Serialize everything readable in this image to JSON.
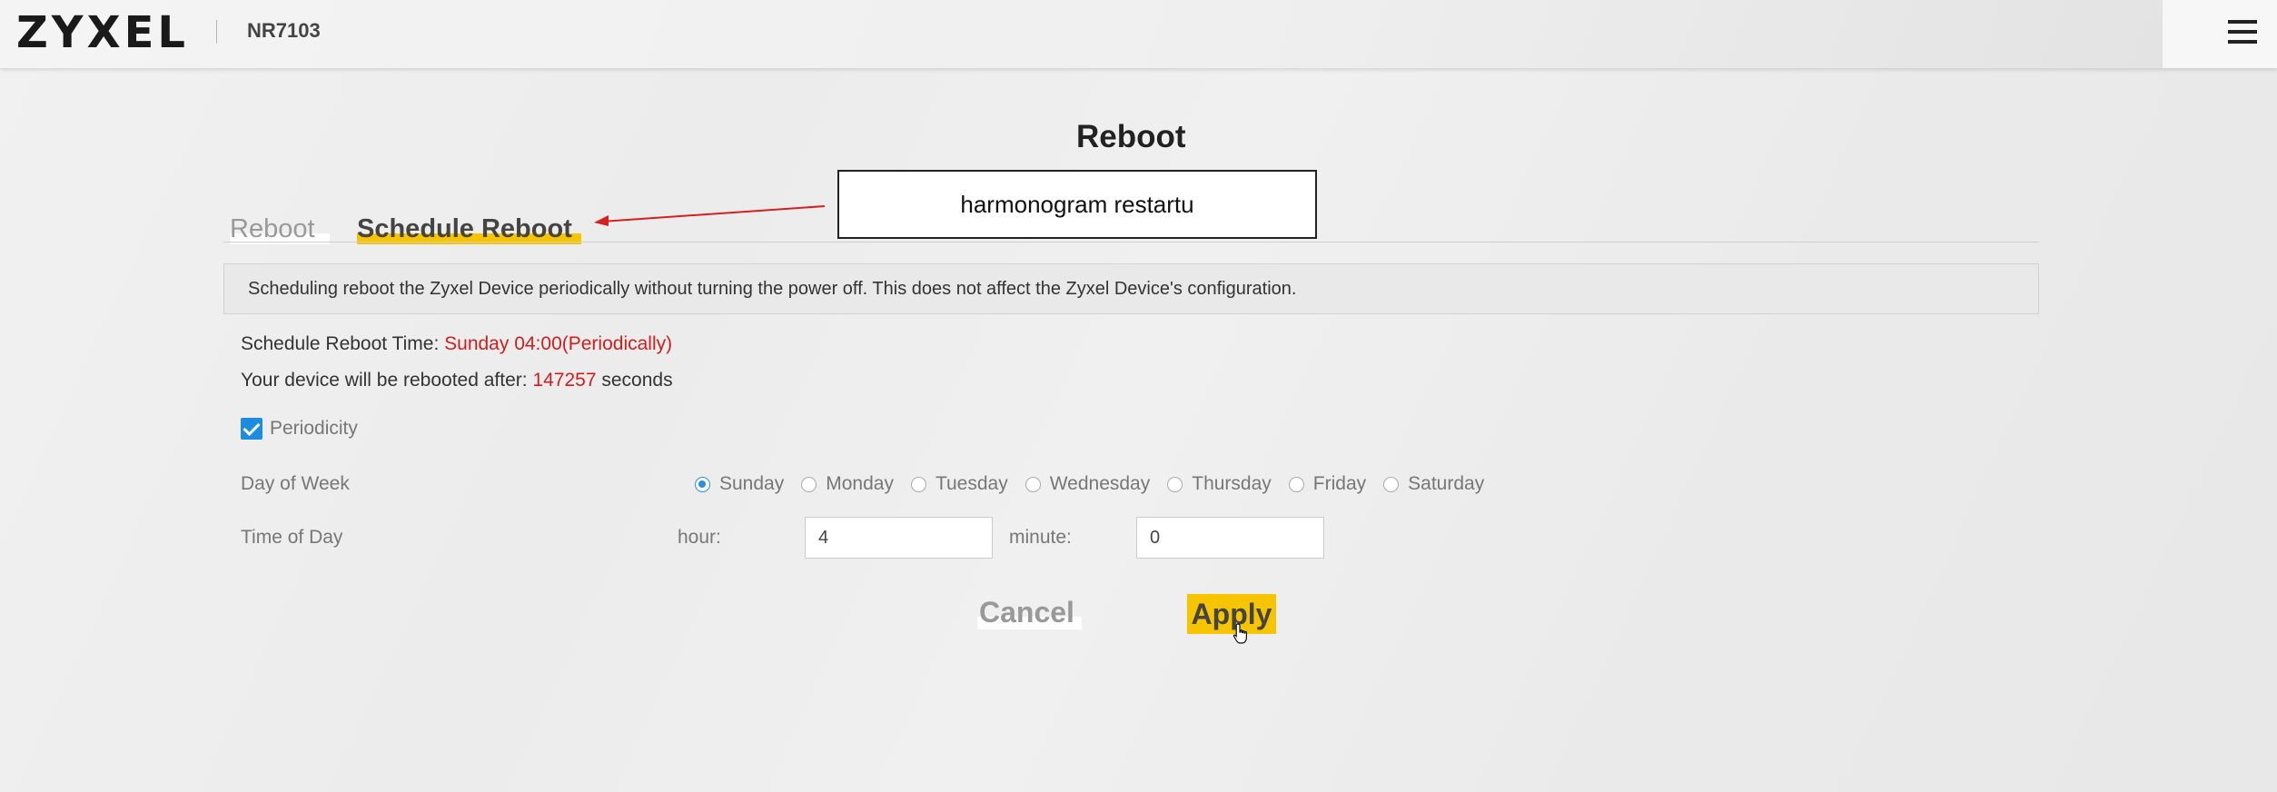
{
  "header": {
    "brand": "ZYXEL",
    "model": "NR7103",
    "menu_icon": "hamburger-menu-icon"
  },
  "page": {
    "title": "Reboot"
  },
  "tabs": [
    {
      "label": "Reboot",
      "active": false
    },
    {
      "label": "Schedule Reboot",
      "active": true
    }
  ],
  "annotation": {
    "text": "harmonogram restartu",
    "arrow_color": "#d42020"
  },
  "info": {
    "text": "Scheduling reboot the Zyxel Device periodically without turning the power off. This does not affect the Zyxel Device's configuration."
  },
  "status": {
    "schedule_label": "Schedule Reboot Time:",
    "schedule_value": "Sunday 04:00(Periodically)",
    "countdown_label": "Your device will be rebooted after:",
    "countdown_value": "147257",
    "countdown_unit": "seconds"
  },
  "form": {
    "periodicity_label": "Periodicity",
    "periodicity_checked": true,
    "day_of_week_label": "Day of Week",
    "days": [
      {
        "label": "Sunday",
        "checked": true
      },
      {
        "label": "Monday",
        "checked": false
      },
      {
        "label": "Tuesday",
        "checked": false
      },
      {
        "label": "Wednesday",
        "checked": false
      },
      {
        "label": "Thursday",
        "checked": false
      },
      {
        "label": "Friday",
        "checked": false
      },
      {
        "label": "Saturday",
        "checked": false
      }
    ],
    "time_of_day_label": "Time of Day",
    "hour_label": "hour:",
    "hour_value": "4",
    "minute_label": "minute:",
    "minute_value": "0"
  },
  "buttons": {
    "cancel": "Cancel",
    "apply": "Apply"
  },
  "colors": {
    "accent": "#f6c500",
    "value_red": "#d01e1e",
    "checkbox_blue": "#1c8ce0"
  }
}
